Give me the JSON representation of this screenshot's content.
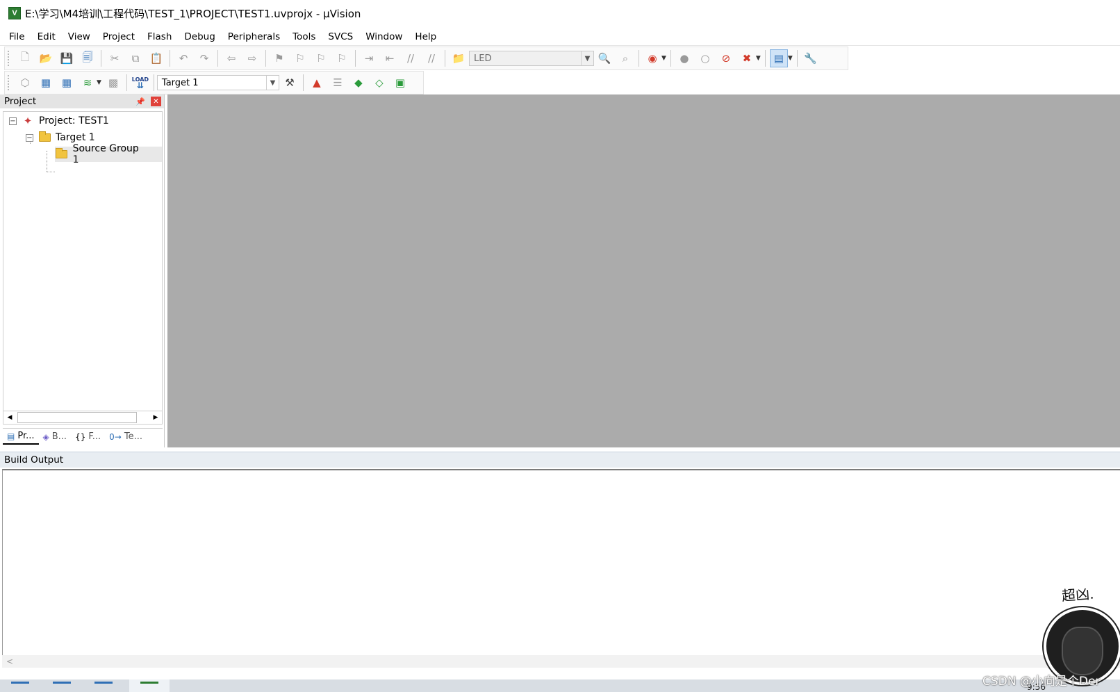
{
  "window": {
    "title": "E:\\学习\\M4培训\\工程代码\\TEST_1\\PROJECT\\TEST1.uvprojx - µVision",
    "app_icon_glyph": "V"
  },
  "menu": [
    "File",
    "Edit",
    "View",
    "Project",
    "Flash",
    "Debug",
    "Peripherals",
    "Tools",
    "SVCS",
    "Window",
    "Help"
  ],
  "toolbar1": {
    "find_combo_value": "LED",
    "find_combo_disabled": true
  },
  "toolbar2": {
    "load_label": "LOAD",
    "target_combo_value": "Target 1"
  },
  "project_panel": {
    "title": "Project",
    "tree": {
      "project": "Project: TEST1",
      "target": "Target 1",
      "group": "Source Group 1"
    },
    "tabs": [
      {
        "label": "Pr...",
        "icon": "project-window-icon",
        "active": true
      },
      {
        "label": "B...",
        "icon": "books-icon",
        "active": false
      },
      {
        "label": "F...",
        "icon": "functions-icon",
        "active": false
      },
      {
        "label": "Te...",
        "icon": "templates-icon",
        "active": false
      }
    ]
  },
  "build_output": {
    "title": "Build Output",
    "content": ""
  },
  "taskbar": {
    "clock": "9:56"
  },
  "watermark": {
    "handwritten": "超凶.",
    "text": "CSDN @小向是个Der"
  },
  "colors": {
    "editor_background": "#ababab",
    "build_header": "#e8edf2",
    "close_button": "#e0413a"
  }
}
